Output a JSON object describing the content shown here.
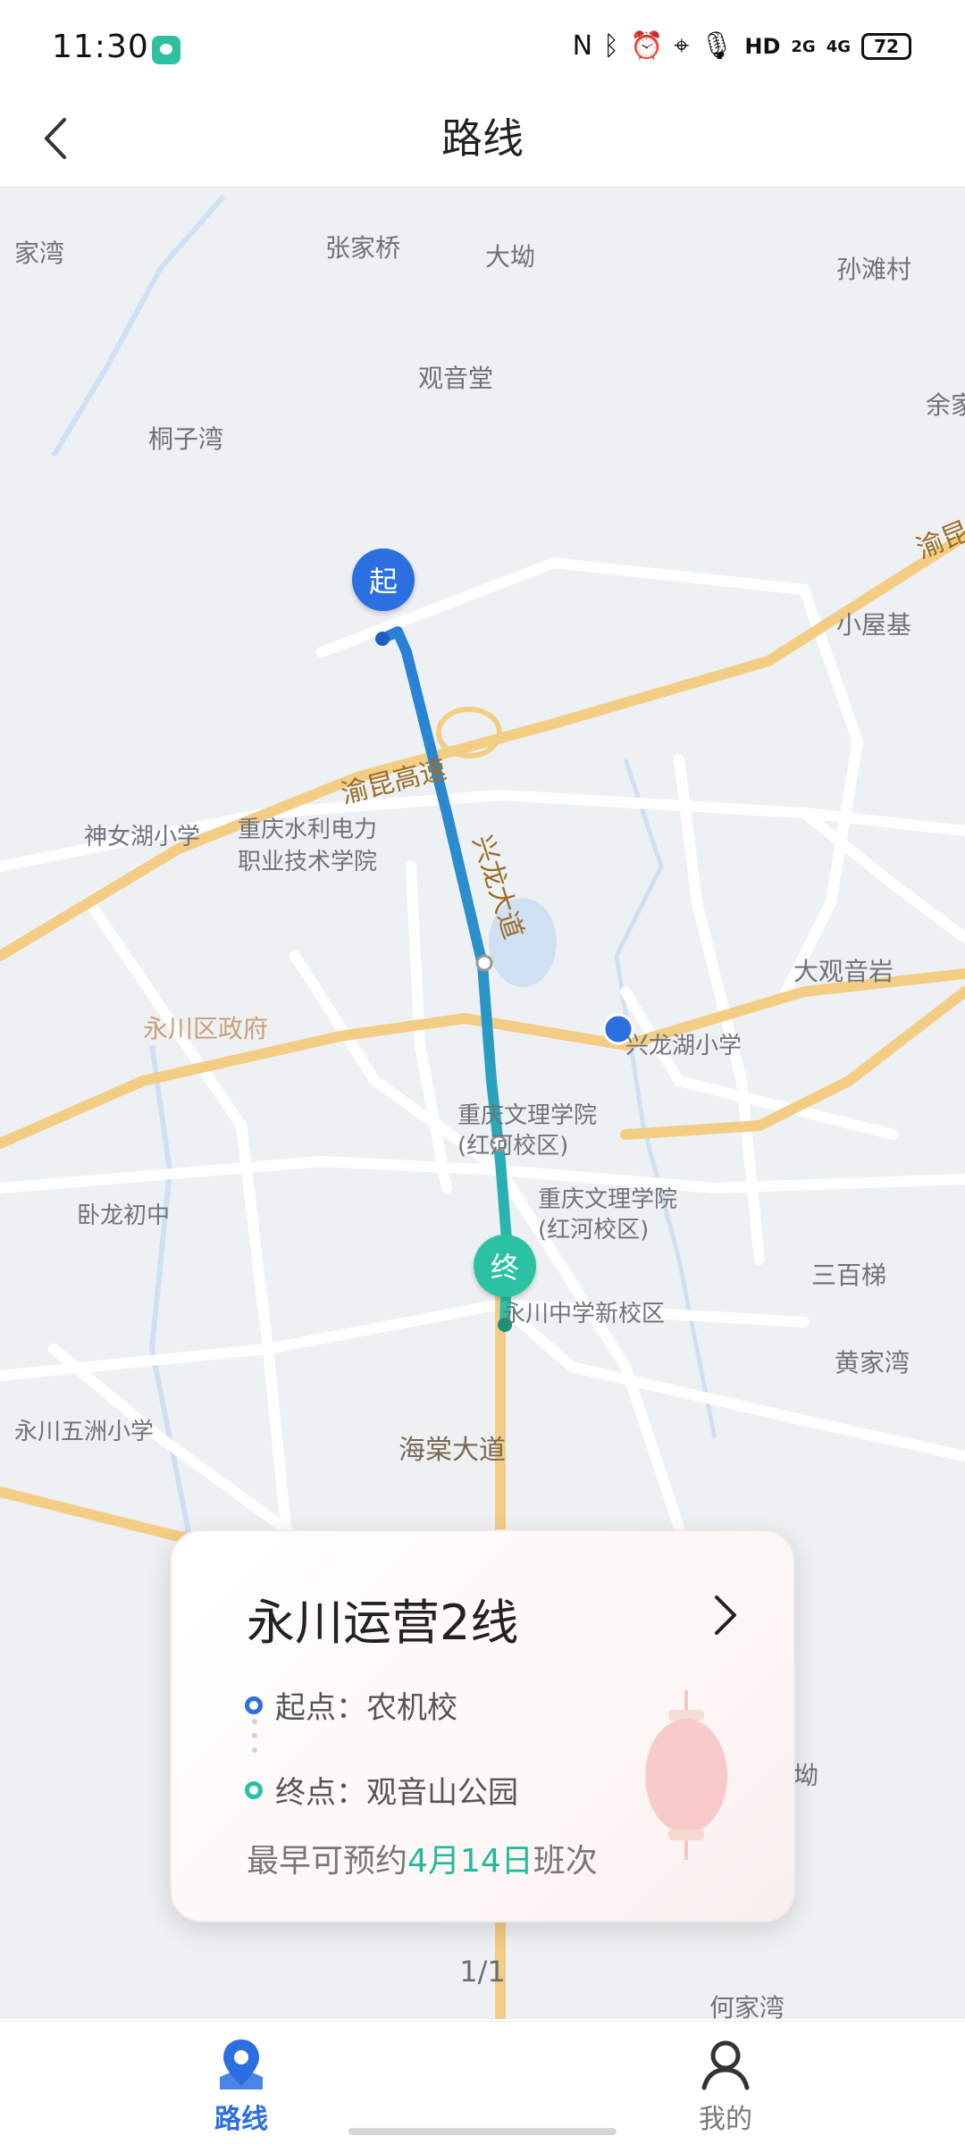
{
  "status_bar": {
    "time": "11:30",
    "network": "HD",
    "signal_1": "2G",
    "signal_2": "4G",
    "battery": "72",
    "icons": [
      "nfc-icon",
      "bluetooth-icon",
      "alarm-icon",
      "location-icon",
      "mic-icon"
    ]
  },
  "header": {
    "title": "路线",
    "back_icon": "chevron-left-icon"
  },
  "map": {
    "places": [
      "家湾",
      "张家桥",
      "大坳",
      "孙滩村",
      "观音堂",
      "余家",
      "桐子湾",
      "小屋基",
      "神女湖小学",
      "重庆水利电力",
      "职业技术学院",
      "大观音岩",
      "永川区政府",
      "兴龙湖小学",
      "重庆文理学院",
      "(红河校区)",
      "重庆文理学院",
      "(红河校区)",
      "卧龙初中",
      "三百梯",
      "永川中学新校区",
      "黄家湾",
      "永川五洲小学",
      "何家湾",
      "坳"
    ],
    "roads": [
      "渝昆高速",
      "兴龙大道",
      "海棠大道",
      "渝昆"
    ],
    "start_marker": "起",
    "end_marker": "终",
    "route_color": "#2a8fd0",
    "route_end_color": "#2bc2a4"
  },
  "route_card": {
    "name": "永川运营2线",
    "start_label": "起点：农机校",
    "end_label": "终点：观音山公园",
    "booking_prefix": "最早可预约",
    "booking_date": "4月14日",
    "booking_suffix": "班次"
  },
  "pager": "1/1",
  "bottom_nav": {
    "items": [
      {
        "label": "路线",
        "icon": "map-pin-icon",
        "active": true
      },
      {
        "label": "我的",
        "icon": "user-icon",
        "active": false
      }
    ],
    "active_color": "#2b6fe0"
  }
}
